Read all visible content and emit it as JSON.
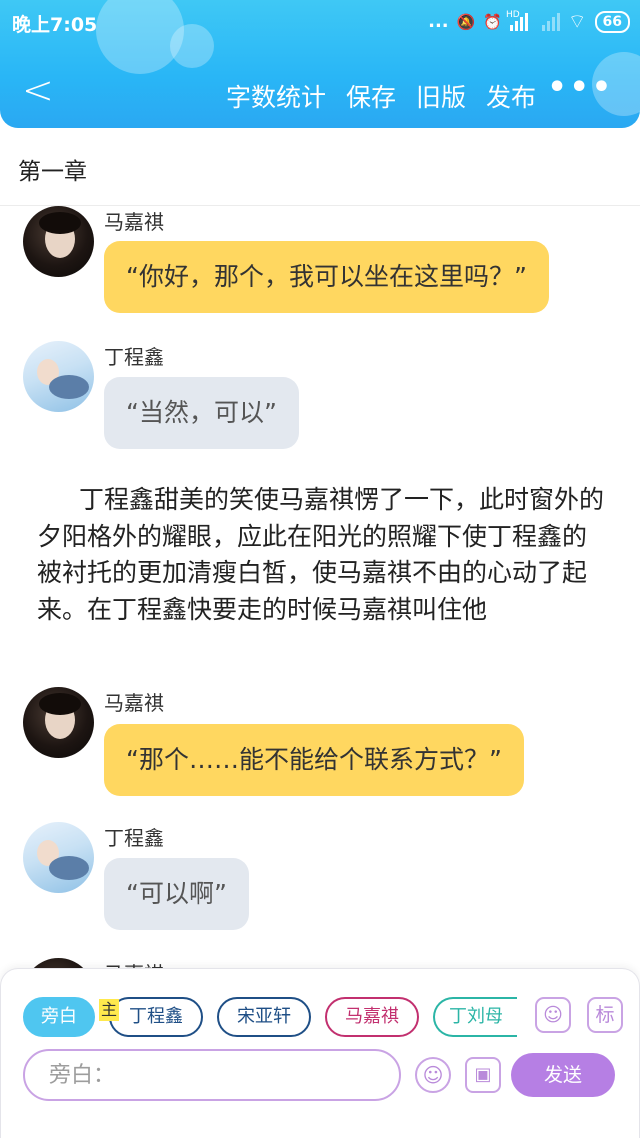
{
  "status_bar": {
    "time": "晚上7:05",
    "battery": "66",
    "dots": "...",
    "alarm_glyph": "⏰",
    "mute_glyph": "🔕",
    "hd_label": "HD",
    "wifi_glyph": "⌔"
  },
  "header": {
    "back_glyph": "<",
    "actions": [
      "字数统计",
      "保存",
      "旧版",
      "发布"
    ],
    "more_glyph": "•••",
    "colors": {
      "bg": "#29b6f6"
    }
  },
  "chapter": {
    "title": "第一章"
  },
  "messages": [
    {
      "speaker": "马嘉祺",
      "text": "“你好，那个，我可以坐在这里吗？”",
      "style": "yellow"
    },
    {
      "speaker": "丁程鑫",
      "text": "“当然，可以”",
      "style": "grey"
    },
    {
      "speaker": "马嘉祺",
      "text": "“那个……能不能给个联系方式？”",
      "style": "yellow"
    },
    {
      "speaker": "丁程鑫",
      "text": "“可以啊”",
      "style": "grey"
    },
    {
      "speaker": "马嘉祺",
      "text": "",
      "style": "yellow"
    }
  ],
  "narration": "丁程鑫甜美的笑使马嘉祺愣了一下，此时窗外的夕阳格外的耀眼，应此在阳光的照耀下使丁程鑫的被衬托的更加清瘦白皙，使马嘉祺不由的心动了起来。在丁程鑫快要走的时候马嘉祺叫住他",
  "roles": {
    "chips": [
      {
        "label": "旁白",
        "color": "#4fc6f0",
        "active": true
      },
      {
        "label": "丁程鑫",
        "color": "#1f4f86",
        "active": false
      },
      {
        "label": "宋亚轩",
        "color": "#1f4f86",
        "active": false
      },
      {
        "label": "马嘉祺",
        "color": "#c2306f",
        "active": false
      },
      {
        "label": "丁刘母",
        "color": "#2bb5a6",
        "active": false
      }
    ],
    "main_tag": "主",
    "role_icon_glyph": "☺",
    "mark_label": "标"
  },
  "input": {
    "placeholder": "旁白：",
    "value": "",
    "emoji_glyph": "☺",
    "image_glyph": "▣",
    "send_label": "发送"
  },
  "colors": {
    "accent_purple": "#b67fe4",
    "bubble_yellow": "#ffd760",
    "bubble_grey": "#e3e8ef"
  }
}
